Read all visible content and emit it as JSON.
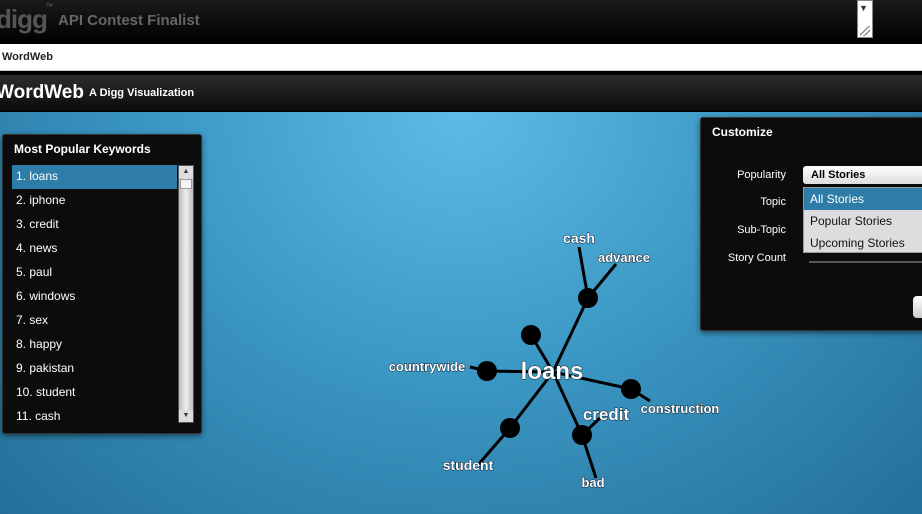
{
  "topbar": {
    "logo": "digg",
    "tm": "™",
    "contest": "API Contest Finalist"
  },
  "tab": {
    "label": "WordWeb"
  },
  "header": {
    "title": "WordWeb",
    "subtitle": "A Digg Visualization"
  },
  "keywords": {
    "title": "Most Popular Keywords",
    "items": [
      "1. loans",
      "2. iphone",
      "3. credit",
      "4. news",
      "5. paul",
      "6. windows",
      "7. sex",
      "8. happy",
      "9. pakistan",
      "10. student",
      "11. cash"
    ]
  },
  "customize": {
    "title": "Customize",
    "labels": {
      "popularity": "Popularity",
      "topic": "Topic",
      "subtopic": "Sub-Topic",
      "story_count": "Story Count"
    },
    "selected": "All Stories",
    "options": [
      "All Stories",
      "Popular Stories",
      "Upcoming Stories"
    ]
  },
  "graph": {
    "center": "loans",
    "words": {
      "cash": "cash",
      "advance": "advance",
      "countrywide": "countrywide",
      "credit": "credit",
      "construction": "construction",
      "student": "student",
      "bad": "bad"
    }
  }
}
